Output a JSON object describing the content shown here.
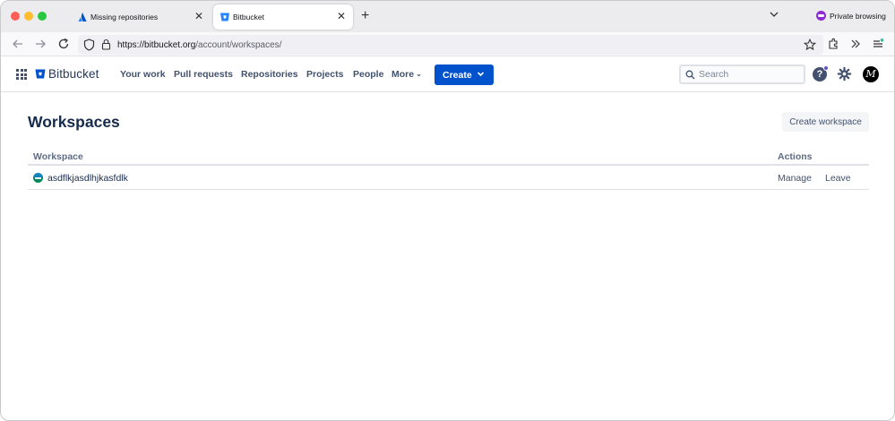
{
  "browser": {
    "tabs": [
      {
        "title": "Missing repositories",
        "active": false
      },
      {
        "title": "Bitbucket",
        "active": true
      }
    ],
    "new_tab_symbol": "+",
    "close_symbol": "✕",
    "private_label": "Private browsing",
    "url": {
      "host": "https://bitbucket.org",
      "path": "/account/workspaces/"
    }
  },
  "header": {
    "logo_text": "Bitbucket",
    "nav": {
      "your_work": "Your work",
      "pull_requests": "Pull requests",
      "repositories": "Repositories",
      "projects": "Projects",
      "people": "People",
      "more": "More"
    },
    "create_label": "Create",
    "search_placeholder": "Search",
    "help_symbol": "?",
    "avatar_initial": "M"
  },
  "page": {
    "title": "Workspaces",
    "create_workspace_label": "Create workspace",
    "table": {
      "columns": {
        "workspace": "Workspace",
        "actions": "Actions"
      },
      "rows": [
        {
          "name": "asdflkjasdlhjkasfdlk",
          "manage": "Manage",
          "leave": "Leave"
        }
      ]
    }
  },
  "colors": {
    "primary": "#0052cc",
    "text": "#172b4d",
    "subtle_text": "#42526e",
    "border": "#dfe1e6",
    "private_purple": "#8f2bd3"
  }
}
